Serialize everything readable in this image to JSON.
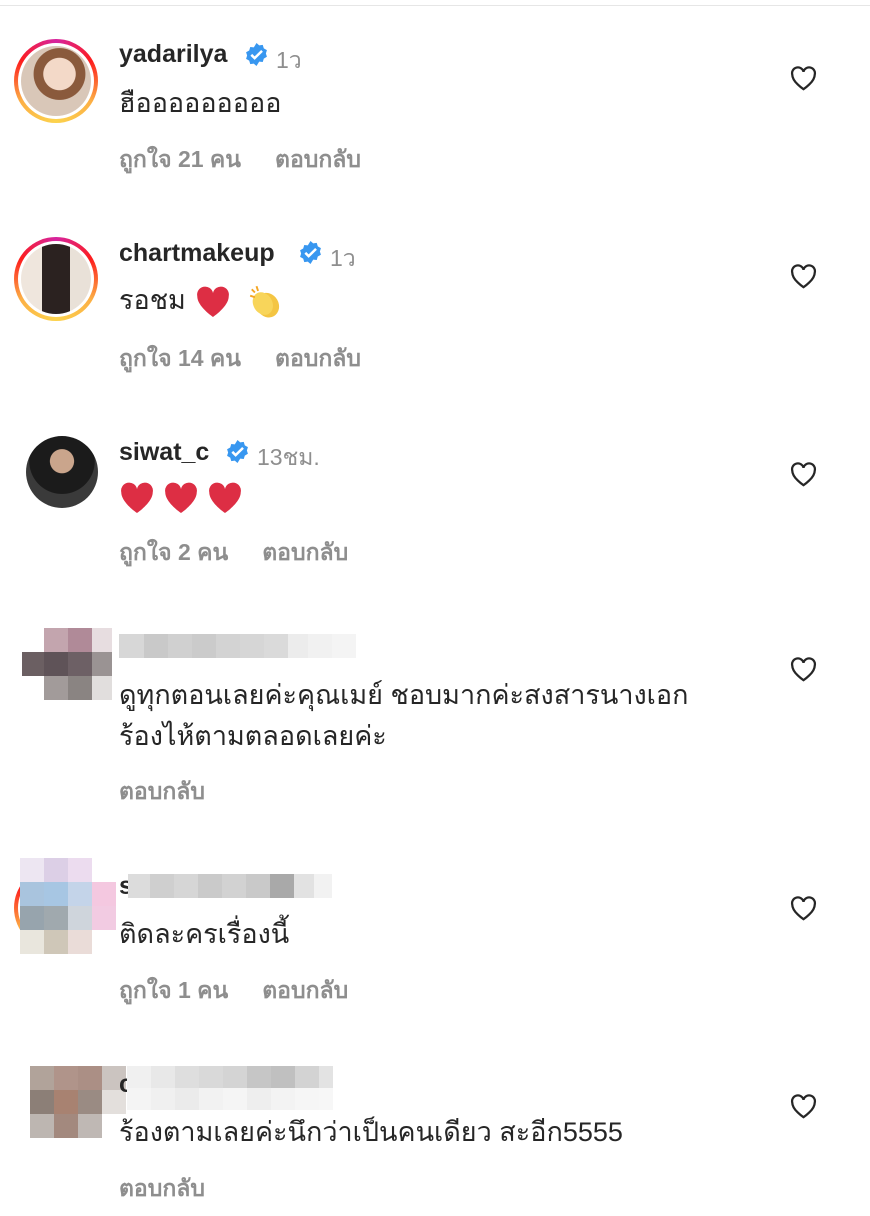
{
  "comments": [
    {
      "username": "yadarilya",
      "verified": true,
      "time": "1ว",
      "text": "ฮือออออออออ",
      "likes": "ถูกใจ 21 คน",
      "reply": "ตอบกลับ"
    },
    {
      "username": "chartmakeup",
      "verified": true,
      "time": "1ว",
      "text": "รอชม",
      "emoji": [
        "red-heart",
        "clapping-hands"
      ],
      "likes": "ถูกใจ 14 คน",
      "reply": "ตอบกลับ"
    },
    {
      "username": "siwat_c",
      "verified": true,
      "time": "13ชม.",
      "emoji": [
        "red-heart",
        "red-heart",
        "red-heart"
      ],
      "likes": "ถูกใจ 2 คน",
      "reply": "ตอบกลับ"
    },
    {
      "username_blurred": true,
      "text_line1": "ดูทุกตอนเลยค่ะคุณเมย์ ชอบมากค่ะสงสารนางเอก",
      "text_line2": "ร้องไห้ตามตลอดเลยค่ะ",
      "reply": "ตอบกลับ"
    },
    {
      "username_prefix": "s",
      "username_blurred": true,
      "text": "ติดละครเรื่องนี้",
      "likes": "ถูกใจ 1 คน",
      "reply": "ตอบกลับ"
    },
    {
      "username_prefix": "c",
      "username_blurred": true,
      "text": "ร้องตามเลยค่ะนึกว่าเป็นคนเดียว สะอีก5555",
      "reply": "ตอบกลับ"
    }
  ],
  "icons": {
    "like": "heart-outline-icon",
    "verified": "verified-badge-icon"
  },
  "colors": {
    "verified": "#3897f0",
    "muted": "#8e8e8e",
    "text": "#262626"
  }
}
